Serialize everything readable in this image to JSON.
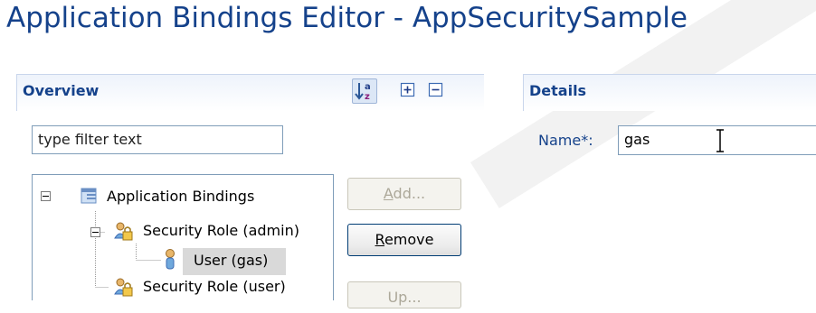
{
  "editor": {
    "title": "Application Bindings Editor - AppSecuritySample"
  },
  "overview": {
    "title": "Overview",
    "toolbar": {
      "sort_icon": "sort-alphabetical-icon",
      "expand_icon": "expand-all-icon",
      "collapse_icon": "collapse-all-icon"
    },
    "filter": {
      "value": "type filter text"
    },
    "tree": [
      {
        "label": "Application Bindings",
        "icon": "application-bindings-icon",
        "expanded": true,
        "selected": false
      },
      {
        "label": "Security Role (admin)",
        "icon": "security-role-icon",
        "expanded": true,
        "selected": false
      },
      {
        "label": "User (gas)",
        "icon": "user-icon",
        "selected": true
      },
      {
        "label": "Security Role (user)",
        "icon": "security-role-icon",
        "selected": false
      }
    ],
    "buttons": {
      "add": {
        "mnemonic": "A",
        "rest": "dd...",
        "enabled": false
      },
      "remove": {
        "mnemonic": "R",
        "rest": "emove",
        "enabled": true
      },
      "up": {
        "label": "Up...",
        "enabled": false
      }
    }
  },
  "details": {
    "title": "Details",
    "name_label": "Name*:",
    "name_value": "gas"
  },
  "colors": {
    "header_text": "#15428b",
    "selection": "#d9d9d9",
    "border": "#7f9db9"
  }
}
